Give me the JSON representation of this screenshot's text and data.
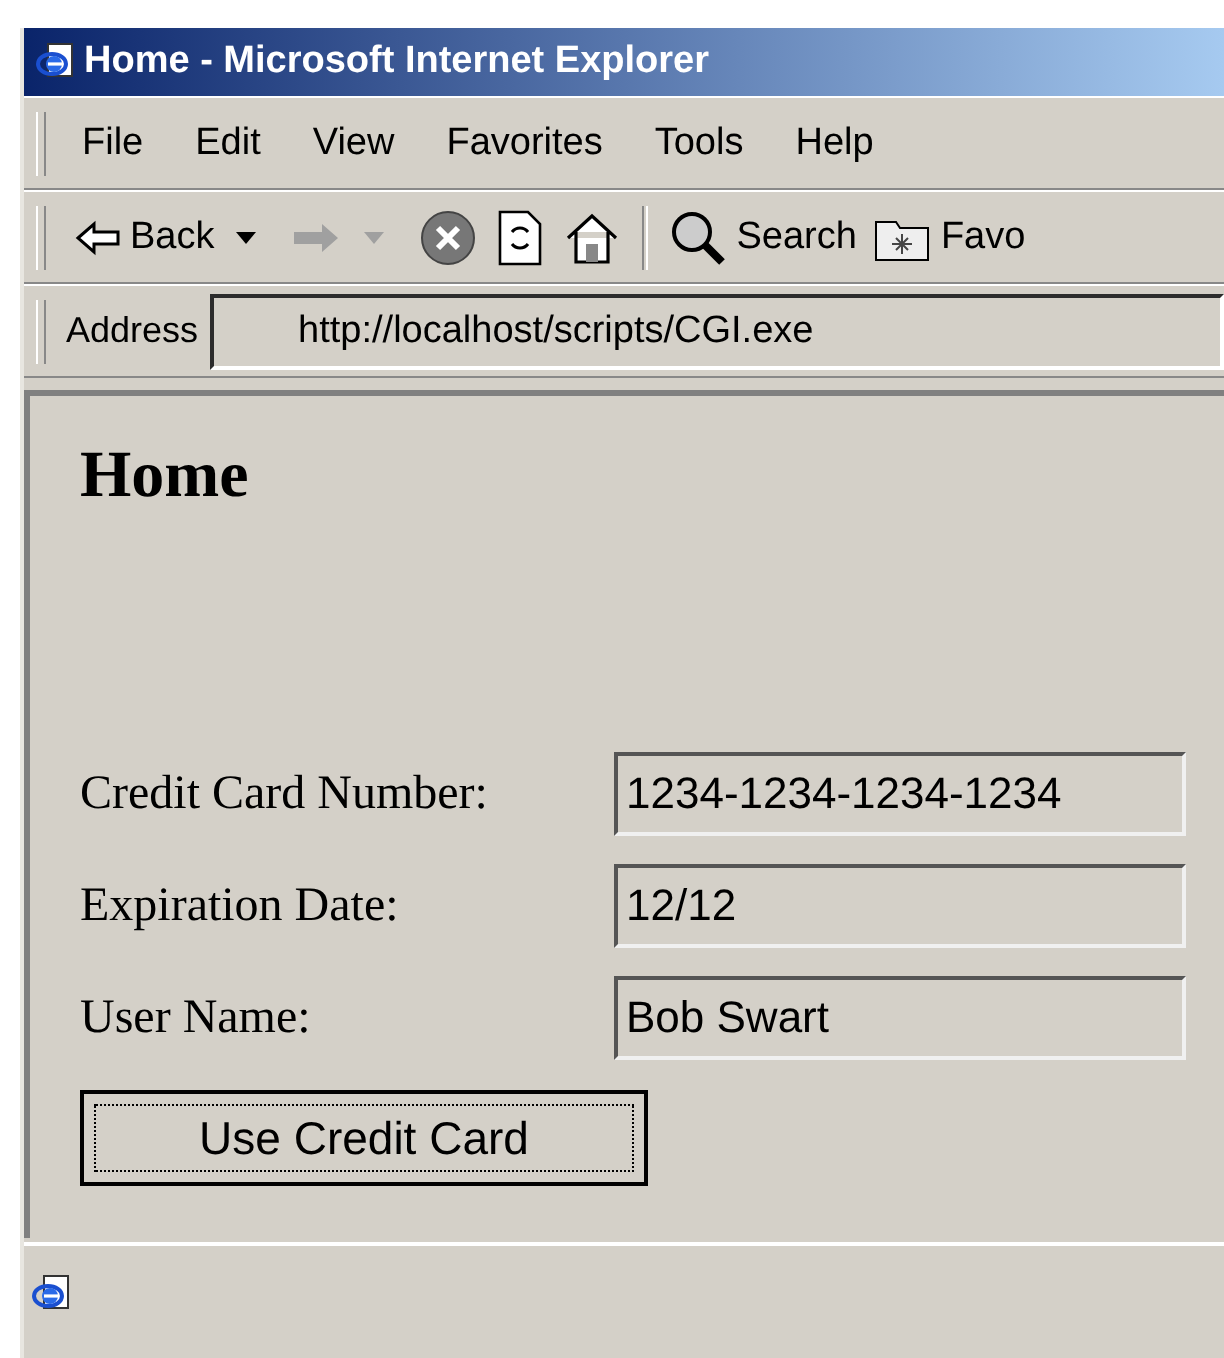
{
  "window": {
    "title": "Home - Microsoft Internet Explorer"
  },
  "menu": [
    "File",
    "Edit",
    "View",
    "Favorites",
    "Tools",
    "Help"
  ],
  "toolbar": [
    {
      "kind": "back",
      "label": "Back",
      "disabled": false
    },
    {
      "kind": "forward",
      "disabled": true
    },
    {
      "kind": "stop",
      "disabled": false
    },
    {
      "kind": "refresh",
      "disabled": false
    },
    {
      "kind": "home",
      "disabled": false
    },
    {
      "kind": "separator"
    },
    {
      "kind": "search",
      "label": "Search",
      "disabled": false
    },
    {
      "kind": "favorites",
      "label": "Favo",
      "disabled": false
    }
  ],
  "address": {
    "label": "Address",
    "value": "http://localhost/scripts/CGI.exe"
  },
  "page": {
    "heading": "Home",
    "fields": [
      {
        "label": "Credit Card Number:",
        "value": "1234-1234-1234-1234"
      },
      {
        "label": "Expiration Date:",
        "value": "12/12"
      },
      {
        "label": "User Name:",
        "value": "Bob Swart"
      }
    ],
    "button": {
      "label": "Use Credit Card",
      "focused": true
    }
  }
}
